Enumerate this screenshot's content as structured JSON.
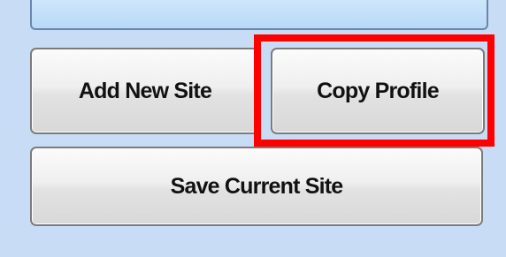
{
  "buttons": {
    "add_new_site": "Add New Site",
    "copy_profile": "Copy Profile",
    "save_current_site": "Save Current Site"
  },
  "colors": {
    "background": "#c8dcf6",
    "highlight": "#ff0000"
  }
}
